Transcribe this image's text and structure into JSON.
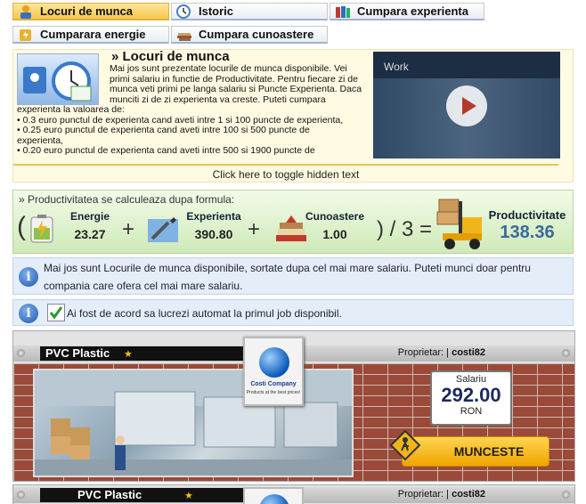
{
  "tabs": [
    {
      "label": "Locuri de munca",
      "icon": "worker-icon",
      "active": true
    },
    {
      "label": "Istoric",
      "icon": "clock-icon",
      "active": false
    },
    {
      "label": "Cumpara experienta",
      "icon": "books-icon",
      "active": false
    },
    {
      "label": "Cumparara energie",
      "icon": "battery-icon",
      "active": false
    },
    {
      "label": "Cumpara cunoastere",
      "icon": "books-icon",
      "active": false
    }
  ],
  "intro": {
    "title": "» Locuri de munca",
    "text_lines": [
      "Mai jos sunt prezentate locurile de munca disponibile. Vei",
      "primi salariu in functie de Productivitate. Pentru fiecare zi de",
      "munca veti primi pe langa salariu si Puncte Experienta. Daca",
      "munciti zi de zi experienta va creste. Puteti cumpara",
      "experienta la valoarea de:",
      "• 0.3 euro punctul de experienta cand aveti intre 1 si 100 puncte de experienta,",
      "• 0.25 euro punctul de experienta cand aveti intre 100 si 500 puncte de",
      "experienta,",
      "• 0.20 euro punctul de experienta cand aveti intre 500 si 1900 puncte de"
    ],
    "video_label": "Work",
    "toggle": "Click here to toggle hidden text"
  },
  "productivity": {
    "caption": "» Productivitatea se calculeaza dupa formula:",
    "energy_label": "Energie",
    "energy_value": "23.27",
    "experience_label": "Experienta",
    "experience_value": "390.80",
    "knowledge_label": "Cunoastere",
    "knowledge_value": "1.00",
    "plus": "+",
    "divider": ") / 3 =",
    "open_paren": "(",
    "result_label": "Productivitate",
    "result_value": "138.36"
  },
  "info1": {
    "line1": "Mai jos sunt Locurile de munca disponibile, sortate dupa cel mai mare salariu. Puteti munci doar pentru",
    "line2": "compania care ofera cel mai mare salariu."
  },
  "info2": {
    "text": "Ai fost de acord sa lucrezi automat la primul job disponibil."
  },
  "job": {
    "name": "PVC Plastic",
    "star": "★",
    "owner_label": "Proprietar: |",
    "owner": "costi82",
    "logo_name": "Costi Company",
    "logo_slogan": "Products at the best prices!",
    "salary_label": "Salariu",
    "salary_value": "292.00",
    "currency": "RON",
    "work_button": "MUNCESTE"
  },
  "job2": {
    "name": "PVC Plastic",
    "star": "★",
    "owner_label": "Proprietar: |",
    "owner": "costi82"
  },
  "colors": {
    "active_tab": "#f6c94d",
    "salary": "#1c2a5c",
    "productivity": "#3a6a9a",
    "brick": "#9b4a3a"
  }
}
